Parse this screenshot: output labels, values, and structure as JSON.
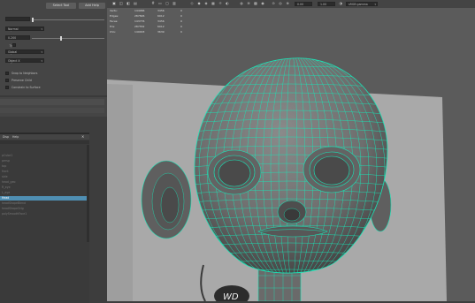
{
  "attribute_panel": {
    "buttons": [
      "Select Tool",
      "Add Help"
    ],
    "rows": [
      {
        "label": "Lo",
        "value": ""
      },
      {
        "label": "Sp",
        "value": "Normal"
      },
      {
        "label": "",
        "value": "0.200"
      },
      {
        "label": "Ty",
        "value": ""
      },
      {
        "label": "Ty",
        "value": "Global"
      },
      {
        "label": "Ty",
        "value": "Object X"
      }
    ],
    "checkboxes": [
      "Snap to Neighbors",
      "Preserve Child",
      "Constrain to Surface"
    ]
  },
  "outliner": {
    "menu": [
      "Disp",
      "Help"
    ],
    "items": [
      {
        "label": "pCube1",
        "selected": false
      },
      {
        "label": "persp",
        "selected": false
      },
      {
        "label": "top",
        "selected": false
      },
      {
        "label": "front",
        "selected": false
      },
      {
        "label": "side",
        "selected": false
      },
      {
        "label": "head_geo",
        "selected": false
      },
      {
        "label": "R_eye",
        "selected": false
      },
      {
        "label": "L_eye",
        "selected": false
      },
      {
        "label": "Head",
        "selected": true
      },
      {
        "label": "headShapeBlend",
        "selected": false
      },
      {
        "label": "headShapeOrig",
        "selected": false
      },
      {
        "label": "polySmoothFace1",
        "selected": false
      }
    ]
  },
  "viewport": {
    "hud": [
      {
        "label": "Verts:",
        "values": [
          "144066",
          "3456",
          "0"
        ]
      },
      {
        "label": "Edges:",
        "values": [
          "287826",
          "6912",
          "0"
        ]
      },
      {
        "label": "Faces:",
        "values": [
          "143776",
          "3456",
          "0"
        ]
      },
      {
        "label": "Tris:",
        "values": [
          "287552",
          "6912",
          "0"
        ]
      },
      {
        "label": "UVs:",
        "values": [
          "149003",
          "3639",
          "0"
        ]
      }
    ],
    "toolbar": {
      "value1": "0.00",
      "value2": "1.00",
      "colorspace": "sRGB gamma"
    },
    "watermark": "WD"
  },
  "colors": {
    "wire": "#19e6b8",
    "selected": "#4f8fb3"
  }
}
